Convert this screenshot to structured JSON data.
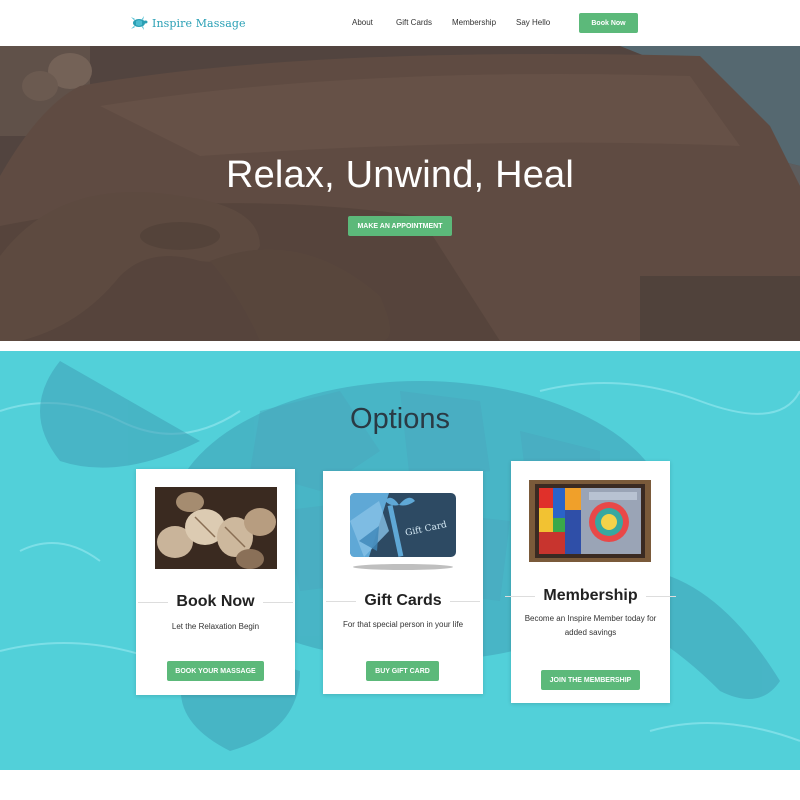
{
  "header": {
    "logo_text": "Inspire Massage",
    "nav": [
      "About",
      "Gift Cards",
      "Membership",
      "Say Hello"
    ],
    "book_now": "Book Now"
  },
  "hero": {
    "title": "Relax, Unwind, Heal",
    "cta": "MAKE AN APPOINTMENT"
  },
  "options": {
    "title": "Options",
    "cards": [
      {
        "title": "Book Now",
        "desc": "Let the Relaxation Begin",
        "button": "BOOK YOUR MASSAGE",
        "image": "firewood-logs-photo"
      },
      {
        "title": "Gift Cards",
        "desc": "For that special person in your life",
        "button": "BUY GIFT CARD",
        "image": "gift-card-graphic",
        "image_text": "Gift Card"
      },
      {
        "title": "Membership",
        "desc": "Become an Inspire Member today for added savings",
        "button": "JOIN THE MEMBERSHIP",
        "image": "stained-glass-photo"
      }
    ]
  },
  "colors": {
    "accent_green": "#5cb97a",
    "logo_blue": "#2aa0b5",
    "options_bg": "#4fd0d8"
  }
}
